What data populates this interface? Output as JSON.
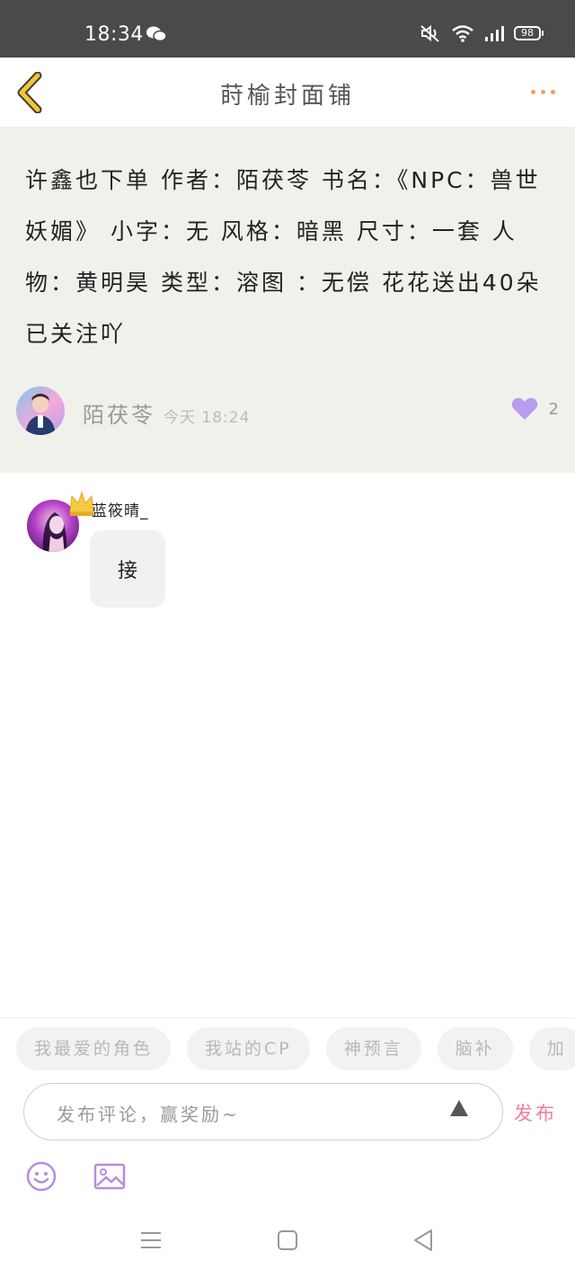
{
  "status_bar": {
    "time": "18:34",
    "battery": "98",
    "icons": [
      "wechat-icon",
      "mute-icon",
      "wifi-icon",
      "signal-icon",
      "battery-icon"
    ]
  },
  "nav": {
    "title": "莳榆封面铺",
    "back_icon": "chevron-left-icon",
    "more_icon": "more-dots-icon"
  },
  "post": {
    "text": "许鑫也下单 作者：陌茯苓 书名：《NPC：兽世妖媚》 小字：无 风格：暗黑 尺寸：一套 人物：黄明昊 类型：溶图 ：无偿 花花送出40朵已关注吖",
    "author": "陌茯苓",
    "time": "今天 18:24",
    "likes": "2"
  },
  "comment": {
    "name": "蓝筱晴_",
    "text": "接"
  },
  "tags": [
    "我最爱的角色",
    "我站的CP",
    "神预言",
    "脑补",
    "加"
  ],
  "input": {
    "placeholder": "发布评论，赢奖励~",
    "publish_label": "发布"
  },
  "colors": {
    "accent_pink": "#f07c97",
    "heart_purple": "#b79cf0",
    "back_yellow": "#f5c531",
    "dots_orange": "#f0a060"
  }
}
